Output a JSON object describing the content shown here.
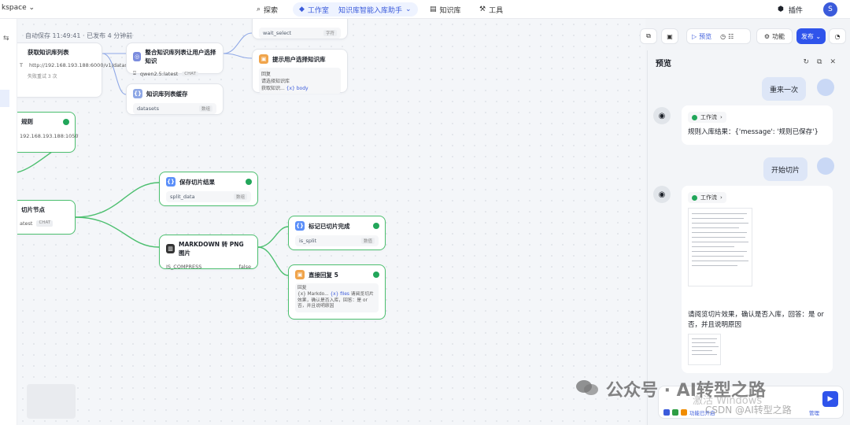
{
  "topbar": {
    "workspace": "kspace",
    "nav": [
      {
        "label": "探索",
        "icon": "explore-icon"
      },
      {
        "label": "工作室",
        "icon": "studio-icon",
        "sub": "知识库智能入库助手"
      },
      {
        "label": "知识库",
        "icon": "book-icon"
      },
      {
        "label": "工具",
        "icon": "tools-icon"
      }
    ],
    "plugin_label": "插件",
    "avatar_letter": "S"
  },
  "canvas": {
    "save_status": "自动保存 11:49:41 · 已发布 4 分钟前",
    "nodes": {
      "get_kb_list": {
        "title": "获取知识库列表",
        "method": "T",
        "url": "http://192.168.193.188:6000/v1/datasets",
        "retry": "失败重试 3 次"
      },
      "integrate": {
        "title": "整合知识库列表让用户选择知识",
        "model": "qwen2.5:latest",
        "tag": "CHAT"
      },
      "kb_cache": {
        "title": "知识库列表缓存",
        "var": "datasets",
        "tag": "数组"
      },
      "wait_select": {
        "var": "wait_select",
        "tag": "字符"
      },
      "prompt_select": {
        "title": "提示用户选择知识库",
        "reply_label": "回复",
        "line1": "请选择知识库",
        "line2a": "获取知识...",
        "line2b": "{x} body"
      },
      "rule": {
        "title": "规则",
        "url": "192.168.193.188:1050"
      },
      "cut": {
        "title": "切片节点",
        "model": "atest",
        "tag": "CHAT"
      },
      "save_split": {
        "title": "保存切片结果",
        "var": "split_data",
        "tag": "数组"
      },
      "md_png": {
        "title": "MARKDOWN 转 PNG 图片",
        "param": "IS_COMPRESS",
        "value": "false"
      },
      "mark_done": {
        "title": "标记已切片完成",
        "var": "is_split",
        "tag": "数值"
      },
      "direct_reply": {
        "title": "直接回复 5",
        "reply_label": "回复",
        "text_a": "{x} Markdo...",
        "text_b": "{x} files",
        "text_c": "请阅览切片效果，确认是否入库，回答：是 or 否，并且说明原因"
      }
    }
  },
  "toolbar": {
    "preview_label": "预览",
    "feature_label": "功能",
    "publish_label": "发布"
  },
  "preview_panel": {
    "title": "预览",
    "messages": [
      {
        "role": "user",
        "text": "重来一次"
      },
      {
        "role": "bot",
        "workflow_label": "工作流",
        "text": "规则入库结果：{'message': '规则已保存'}"
      },
      {
        "role": "user",
        "text": "开始切片"
      },
      {
        "role": "bot",
        "workflow_label": "工作流",
        "text": "请阅览切片效果，确认是否入库，回答：是 or 否，并且说明原因"
      }
    ],
    "composer_hint": "功能已开启",
    "composer_right": "管理"
  },
  "watermarks": {
    "wechat": "公众号 · AI转型之路",
    "windows": "激活 Windows",
    "csdn": "CSDN @AI转型之路"
  }
}
